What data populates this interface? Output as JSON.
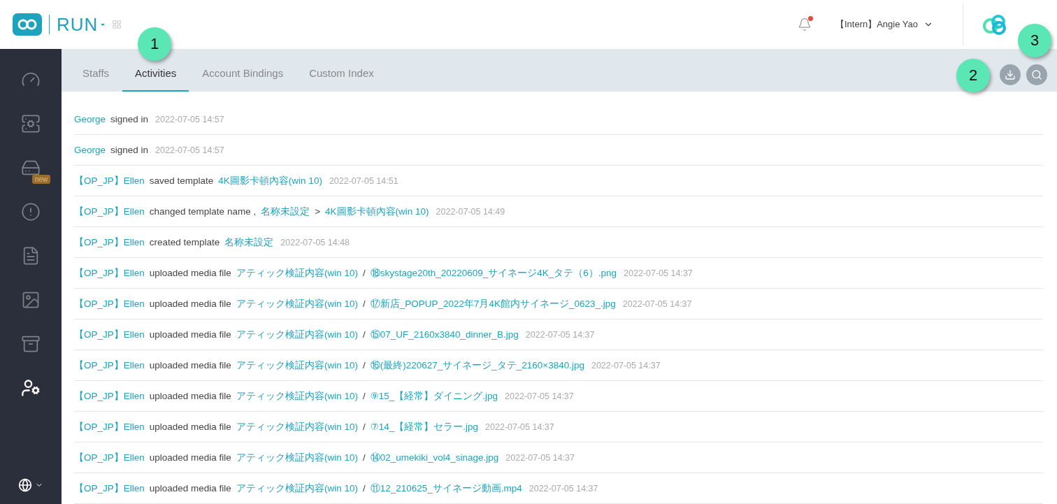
{
  "header": {
    "product": "RUN",
    "user": "【Intern】Angie Yao",
    "notification": true
  },
  "sidebar": {
    "items": [
      {
        "selected": false
      },
      {
        "selected": false
      },
      {
        "selected": false,
        "badge": "new"
      },
      {
        "selected": false
      },
      {
        "selected": false
      },
      {
        "selected": false
      },
      {
        "selected": false
      },
      {
        "selected": true
      }
    ]
  },
  "tabs": [
    {
      "label": "Staffs",
      "selected": false
    },
    {
      "label": "Activities",
      "selected": true
    },
    {
      "label": "Account Bindings",
      "selected": false
    },
    {
      "label": "Custom Index",
      "selected": false
    }
  ],
  "callouts": [
    {
      "label": "1"
    },
    {
      "label": "2"
    },
    {
      "label": "3"
    }
  ],
  "activities": [
    {
      "actor": "George",
      "segments": [
        {
          "kind": "text",
          "text": "signed in"
        }
      ],
      "time": "2022-07-05 14:57"
    },
    {
      "actor": "George",
      "segments": [
        {
          "kind": "text",
          "text": "signed in"
        }
      ],
      "time": "2022-07-05 14:57"
    },
    {
      "actor": "【OP_JP】Ellen",
      "segments": [
        {
          "kind": "text",
          "text": "saved template"
        },
        {
          "kind": "link",
          "text": "4K圖影卡頓內容(win 10)"
        }
      ],
      "time": "2022-07-05 14:51"
    },
    {
      "actor": "【OP_JP】Ellen",
      "segments": [
        {
          "kind": "text",
          "text": "changed template name ,"
        },
        {
          "kind": "link",
          "text": "名称未設定"
        },
        {
          "kind": "text",
          "text": ">"
        },
        {
          "kind": "link",
          "text": "4K圖影卡頓內容(win 10)"
        }
      ],
      "time": "2022-07-05 14:49"
    },
    {
      "actor": "【OP_JP】Ellen",
      "segments": [
        {
          "kind": "text",
          "text": "created template"
        },
        {
          "kind": "link",
          "text": "名称未設定"
        }
      ],
      "time": "2022-07-05 14:48"
    },
    {
      "actor": "【OP_JP】Ellen",
      "segments": [
        {
          "kind": "text",
          "text": "uploaded media file"
        },
        {
          "kind": "link",
          "text": "アティック検証内容(win 10)"
        },
        {
          "kind": "text",
          "text": "/"
        },
        {
          "kind": "link",
          "text": "⑱skystage20th_20220609_サイネージ4K_タテ（6）.png"
        }
      ],
      "time": "2022-07-05 14:37"
    },
    {
      "actor": "【OP_JP】Ellen",
      "segments": [
        {
          "kind": "text",
          "text": "uploaded media file"
        },
        {
          "kind": "link",
          "text": "アティック検証内容(win 10)"
        },
        {
          "kind": "text",
          "text": "/"
        },
        {
          "kind": "link",
          "text": "⑰新店_POPUP_2022年7月4K館内サイネージ_0623_.jpg"
        }
      ],
      "time": "2022-07-05 14:37"
    },
    {
      "actor": "【OP_JP】Ellen",
      "segments": [
        {
          "kind": "text",
          "text": "uploaded media file"
        },
        {
          "kind": "link",
          "text": "アティック検証内容(win 10)"
        },
        {
          "kind": "text",
          "text": "/"
        },
        {
          "kind": "link",
          "text": "⑮07_UF_2160x3840_dinner_B.jpg"
        }
      ],
      "time": "2022-07-05 14:37"
    },
    {
      "actor": "【OP_JP】Ellen",
      "segments": [
        {
          "kind": "text",
          "text": "uploaded media file"
        },
        {
          "kind": "link",
          "text": "アティック検証内容(win 10)"
        },
        {
          "kind": "text",
          "text": "/"
        },
        {
          "kind": "link",
          "text": "⑯(最終)220627_サイネージ_タテ_2160×3840.jpg"
        }
      ],
      "time": "2022-07-05 14:37"
    },
    {
      "actor": "【OP_JP】Ellen",
      "segments": [
        {
          "kind": "text",
          "text": "uploaded media file"
        },
        {
          "kind": "link",
          "text": "アティック検証内容(win 10)"
        },
        {
          "kind": "text",
          "text": "/"
        },
        {
          "kind": "link",
          "text": "⑨15_【経常】ダイニング.jpg"
        }
      ],
      "time": "2022-07-05 14:37"
    },
    {
      "actor": "【OP_JP】Ellen",
      "segments": [
        {
          "kind": "text",
          "text": "uploaded media file"
        },
        {
          "kind": "link",
          "text": "アティック検証内容(win 10)"
        },
        {
          "kind": "text",
          "text": "/"
        },
        {
          "kind": "link",
          "text": "⑦14_【経常】セラー.jpg"
        }
      ],
      "time": "2022-07-05 14:37"
    },
    {
      "actor": "【OP_JP】Ellen",
      "segments": [
        {
          "kind": "text",
          "text": "uploaded media file"
        },
        {
          "kind": "link",
          "text": "アティック検証内容(win 10)"
        },
        {
          "kind": "text",
          "text": "/"
        },
        {
          "kind": "link",
          "text": "⑭02_umekiki_vol4_sinage.jpg"
        }
      ],
      "time": "2022-07-05 14:37"
    },
    {
      "actor": "【OP_JP】Ellen",
      "segments": [
        {
          "kind": "text",
          "text": "uploaded media file"
        },
        {
          "kind": "link",
          "text": "アティック検証内容(win 10)"
        },
        {
          "kind": "text",
          "text": "/"
        },
        {
          "kind": "link",
          "text": "⑪12_210625_サイネージ動画.mp4"
        }
      ],
      "time": "2022-07-05 14:37"
    }
  ]
}
